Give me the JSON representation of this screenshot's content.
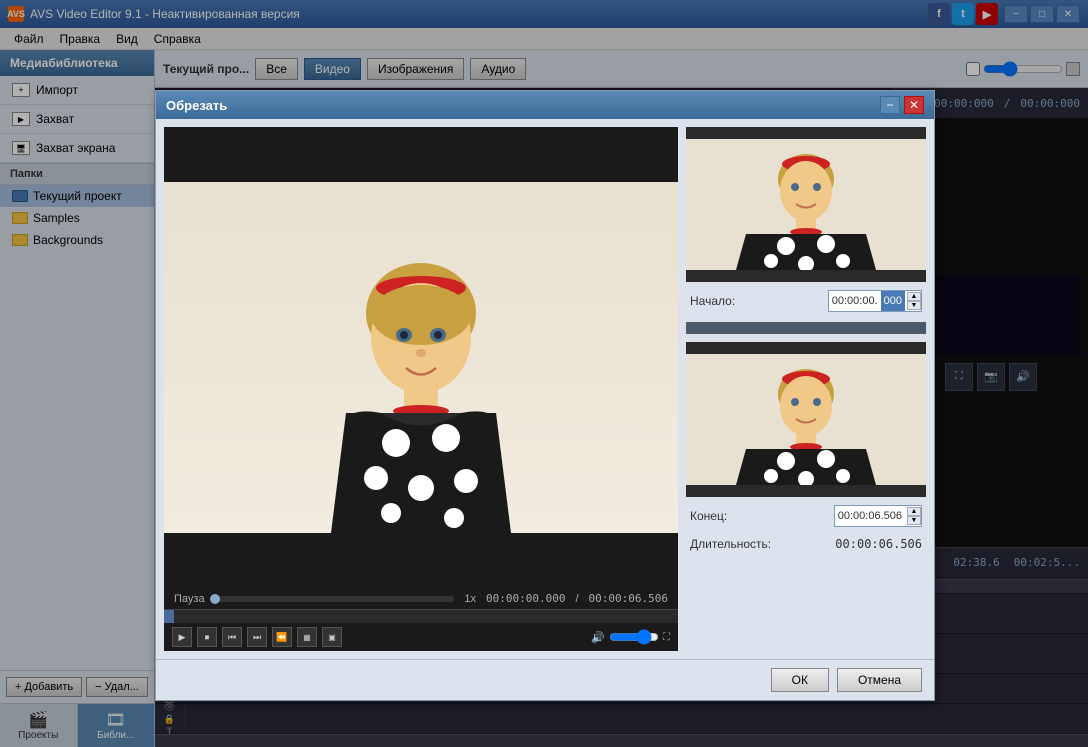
{
  "app": {
    "title": "AVS Video Editor 9.1 - Неактивированная версия",
    "logo": "AVS"
  },
  "titlebar": {
    "minimize": "−",
    "maximize": "□",
    "close": "✕"
  },
  "menubar": {
    "items": [
      "Файл",
      "Правка",
      "Вид",
      "Справка"
    ]
  },
  "social": {
    "facebook": "f",
    "twitter": "t",
    "youtube": "▶"
  },
  "sidebar": {
    "header": "Медиабиблиотека",
    "buttons": [
      {
        "icon": "+",
        "label": "Импорт"
      },
      {
        "icon": "⬛",
        "label": "Захват"
      },
      {
        "icon": "🖥",
        "label": "Захват экрана"
      }
    ],
    "folders_header": "Папки",
    "folders": [
      {
        "label": "Текущий проект",
        "type": "blue",
        "selected": true
      },
      {
        "label": "Samples",
        "type": "yellow"
      },
      {
        "label": "Backgrounds",
        "type": "yellow"
      }
    ],
    "add_label": "+ Добавить",
    "remove_label": "− Удал..."
  },
  "toolbar": {
    "current_project": "Текущий про...",
    "tabs": [
      "Все",
      "Видео",
      "Изображения",
      "Аудио"
    ]
  },
  "dialog": {
    "title": "Обрезать",
    "minimize": "−",
    "close": "✕",
    "start_label": "Начало:",
    "start_value": "00:00:00.",
    "start_highlight": "000",
    "end_label": "Конец:",
    "end_value": "00:00:06.506",
    "duration_label": "Длительность:",
    "duration_value": "00:00:06.506",
    "ok_label": "ОК",
    "cancel_label": "Отмена"
  },
  "player": {
    "status": "Пауза",
    "speed": "1x",
    "time_current": "00:00:00.000",
    "time_total": "00:00:06.506",
    "controls": [
      "▶",
      "⏹",
      "⏮",
      "⏭",
      "⏪",
      "▦",
      "▣"
    ]
  },
  "timeline": {
    "time1": "00:00:000",
    "time2": "00:00:000",
    "time_display": "02:38.6",
    "time_display2": "00:02:5..."
  },
  "tracks": {
    "track1_icon": "🎬",
    "track2_icon": "↔",
    "track3_icon": "👁",
    "track4_icon": "🔒",
    "track5_icon": "T"
  }
}
